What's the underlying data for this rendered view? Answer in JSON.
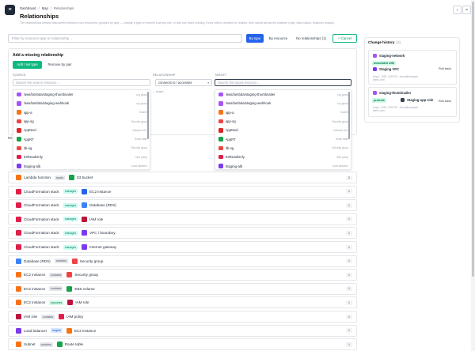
{
  "header": {
    "breadcrumbs": [
      "Dashboard",
      "Map",
      "Relationships"
    ],
    "breadcrumb_sep": "/",
    "title": "Relationships",
    "description": "The relationships Meshpi discovered between your resources, grouped by type — change a type or remove a wrong one, or add one that's missing. Every edit is checked for realism, then saved across the platform (map, blast radius, business impact).",
    "menu_icon": "hamburger-icon",
    "back_glyph": "‹",
    "close_glyph": "×"
  },
  "filter": {
    "placeholder": "Filter by resource type or relationship..."
  },
  "view_tabs": {
    "by_type": "By type",
    "by_resource": "By resource",
    "no_rel": "No relationships (1)",
    "cancel": "+ Cancel"
  },
  "add_panel": {
    "title": "Add a missing relationship",
    "add_tab": "Add / set type",
    "remove_tab": "Remove by pair",
    "source_label": "SOURCE",
    "source_placeholder": "Search the source resource…",
    "relationship_label": "RELATIONSHIP",
    "relationship_value": "connects to / accesses",
    "arrow_text": "→ target",
    "target_label": "TARGET",
    "target_placeholder": "Search the target resource…"
  },
  "dropdown_items": [
    {
      "name": "/aws/lambda/staging-thumbnailer",
      "kind": "Log group",
      "color": "#a855f7"
    },
    {
      "name": "/aws/lambda/staging-webhook",
      "kind": "Log group",
      "color": "#a855f7"
    },
    {
      "name": "app-a",
      "kind": "Subnet",
      "color": "#f97316"
    },
    {
      "name": "app-sg",
      "kind": "Security group",
      "color": "#ef4444"
    },
    {
      "name": "AppNacl",
      "kind": "Network ACL",
      "color": "#dc2626"
    },
    {
      "name": "AppRT",
      "kind": "Route table",
      "color": "#16a34a"
    },
    {
      "name": "db-sg",
      "kind": "Security group",
      "color": "#ef4444"
    },
    {
      "name": "S3ReadOnly",
      "kind": "IAM policy",
      "color": "#e11d48"
    },
    {
      "name": "Staging-alb",
      "kind": "Load balancer",
      "color": "#7c3aed"
    }
  ],
  "list_head": "Re",
  "colors": {
    "accent": "#2563eb",
    "green": "#10b981",
    "purple": "#7c3aed"
  },
  "relationships": [
    {
      "src": "Lambda function",
      "src_color": "#f97316",
      "verb": "reads",
      "verb_bg": "#e5e7eb",
      "verb_fg": "#4b5563",
      "dst": "S3 bucket",
      "dst_color": "#16a34a",
      "count": "2"
    },
    {
      "src": "CloudFormation stack",
      "src_color": "#e11d48",
      "verb": "manages",
      "verb_bg": "#ccfbf1",
      "verb_fg": "#0f766e",
      "dst": "EC2 instance",
      "dst_color": "#2563eb",
      "count": "1"
    },
    {
      "src": "CloudFormation stack",
      "src_color": "#e11d48",
      "verb": "manages",
      "verb_bg": "#ccfbf1",
      "verb_fg": "#0f766e",
      "dst": "Database (RDS)",
      "dst_color": "#3b82f6",
      "count": "1"
    },
    {
      "src": "CloudFormation stack",
      "src_color": "#e11d48",
      "verb": "manages",
      "verb_bg": "#ccfbf1",
      "verb_fg": "#0f766e",
      "dst": "IAM role",
      "dst_color": "#be123c",
      "count": "1"
    },
    {
      "src": "CloudFormation stack",
      "src_color": "#e11d48",
      "verb": "manages",
      "verb_bg": "#ccfbf1",
      "verb_fg": "#0f766e",
      "dst": "VPC / boundary",
      "dst_color": "#7c3aed",
      "count": "1"
    },
    {
      "src": "CloudFormation stack",
      "src_color": "#e11d48",
      "verb": "manages",
      "verb_bg": "#ccfbf1",
      "verb_fg": "#0f766e",
      "dst": "Internet gateway",
      "dst_color": "#7c3aed",
      "count": "1"
    },
    {
      "src": "Database (RDS)",
      "src_color": "#3b82f6",
      "verb": "contains",
      "verb_bg": "#e5e7eb",
      "verb_fg": "#4b5563",
      "dst": "Security group",
      "dst_color": "#ef4444",
      "count": "1"
    },
    {
      "src": "EC2 instance",
      "src_color": "#f97316",
      "verb": "contains",
      "verb_bg": "#e5e7eb",
      "verb_fg": "#4b5563",
      "dst": "Security group",
      "dst_color": "#ef4444",
      "count": "1"
    },
    {
      "src": "EC2 instance",
      "src_color": "#f97316",
      "verb": "contains",
      "verb_bg": "#e5e7eb",
      "verb_fg": "#4b5563",
      "dst": "EBS volume",
      "dst_color": "#16a34a",
      "count": "1"
    },
    {
      "src": "EC2 instance",
      "src_color": "#f97316",
      "verb": "assumes",
      "verb_bg": "#d1fae5",
      "verb_fg": "#047857",
      "dst": "IAM role",
      "dst_color": "#be123c",
      "count": "1"
    },
    {
      "src": "IAM role",
      "src_color": "#be123c",
      "verb": "contains",
      "verb_bg": "#e5e7eb",
      "verb_fg": "#4b5563",
      "dst": "IAM policy",
      "dst_color": "#e11d48",
      "count": "1"
    },
    {
      "src": "Load balancer",
      "src_color": "#7c3aed",
      "verb": "targets",
      "verb_bg": "#dbeafe",
      "verb_fg": "#1d4ed8",
      "dst": "EC2 instance",
      "dst_color": "#f97316",
      "count": "1"
    },
    {
      "src": "Subnet",
      "src_color": "#f97316",
      "verb": "contains",
      "verb_bg": "#e5e7eb",
      "verb_fg": "#4b5563",
      "dst": "Route table",
      "dst_color": "#16a34a",
      "count": "1"
    }
  ],
  "history": {
    "title": "Change history",
    "count": "(2)",
    "entries": [
      {
        "source": "staging-network",
        "verb": "associated with",
        "target": "Staging VPC",
        "meta": "Aug 4, 2026, 3:29 PM · demo@example-demo.com",
        "rollback": "Roll back"
      },
      {
        "source": "staging-thumbnailer",
        "verb": "protects",
        "target": "Staging-app-role",
        "meta": "Aug 4, 2026, 3:29 PM · demo@example-demo.com",
        "rollback": "Roll back"
      }
    ]
  }
}
